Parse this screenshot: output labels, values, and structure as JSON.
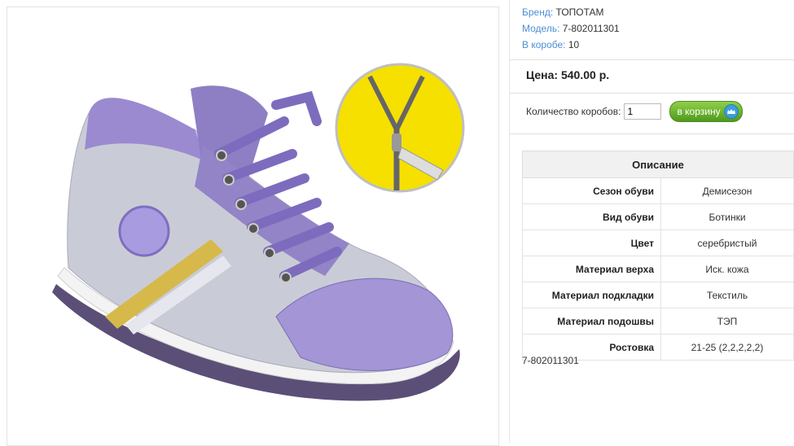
{
  "product": {
    "brand_label": "Бренд:",
    "brand_value": "ТОПОТАМ",
    "model_label": "Модель:",
    "model_value": "7-802011301",
    "box_label": "В коробе:",
    "box_value": "10",
    "price": "Цена: 540.00 р.",
    "image_alt": "zipper"
  },
  "cart": {
    "qty_label": "Количество коробов:",
    "qty_value": "1",
    "button_label": "в корзину"
  },
  "specs": {
    "title": "Описание",
    "rows": [
      {
        "key": "Сезон обуви",
        "value": "Демисезон"
      },
      {
        "key": "Вид обуви",
        "value": "Ботинки"
      },
      {
        "key": "Цвет",
        "value": "серебристый"
      },
      {
        "key": "Материал верха",
        "value": "Иск. кожа"
      },
      {
        "key": "Материал подкладки",
        "value": "Текстиль"
      },
      {
        "key": "Материал подошвы",
        "value": "ТЭП"
      },
      {
        "key": "Ростовка",
        "value": "21-25 (2,2,2,2,2)"
      }
    ]
  },
  "footer_model": "7-802011301",
  "colors": {
    "link_blue": "#4a8fd6",
    "button_green": "#5fa82a",
    "boot_purple": "#9b8ad0",
    "boot_silver": "#c9ccd6",
    "zipper_yellow": "#f5e000"
  }
}
